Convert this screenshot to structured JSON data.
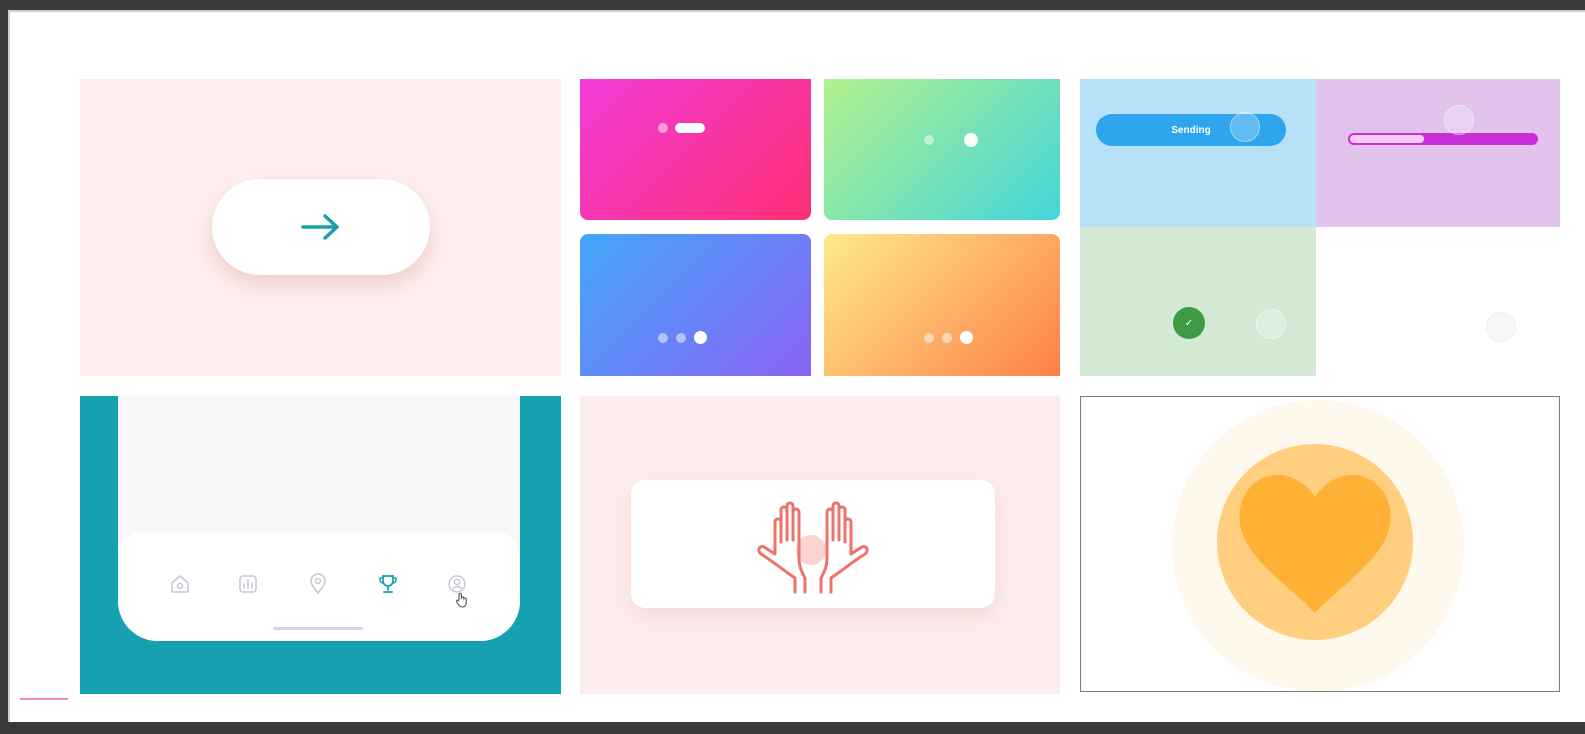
{
  "tiles": {
    "arrow": {
      "icon": "arrow-right-icon",
      "color": "#1aa0aa"
    },
    "dot_indicators": [
      {
        "gradient": [
          "#f23bd8",
          "#ff2f75"
        ],
        "active_index": 1,
        "count": 2
      },
      {
        "gradient": [
          "#b3f18c",
          "#43d5dc"
        ],
        "active_index": 1,
        "count": 2
      },
      {
        "gradient": [
          "#43a8fb",
          "#8a62f4"
        ],
        "active_index": 2,
        "count": 3
      },
      {
        "gradient": [
          "#fdea8c",
          "#ff7f48"
        ],
        "active_index": 2,
        "count": 3
      }
    ],
    "sending": {
      "label": "Sending",
      "color": "#2ea5ed"
    },
    "progress": {
      "value_fraction": 0.4,
      "color": "#c92fd6"
    },
    "success": {
      "icon": "check-icon",
      "color": "#3c9b43"
    },
    "nav_bar": {
      "background": "#16a1b1",
      "items": [
        {
          "icon": "home-icon",
          "active": false
        },
        {
          "icon": "chart-icon",
          "active": false
        },
        {
          "icon": "location-pin-icon",
          "active": false
        },
        {
          "icon": "trophy-icon",
          "active": true
        },
        {
          "icon": "profile-icon",
          "active": false
        }
      ],
      "active_color": "#16a1b1"
    },
    "high_five": {
      "icon": "high-five-hands-icon",
      "color": "#f0706a"
    },
    "heart": {
      "icon": "heart-icon",
      "color": "#ffb135"
    }
  }
}
